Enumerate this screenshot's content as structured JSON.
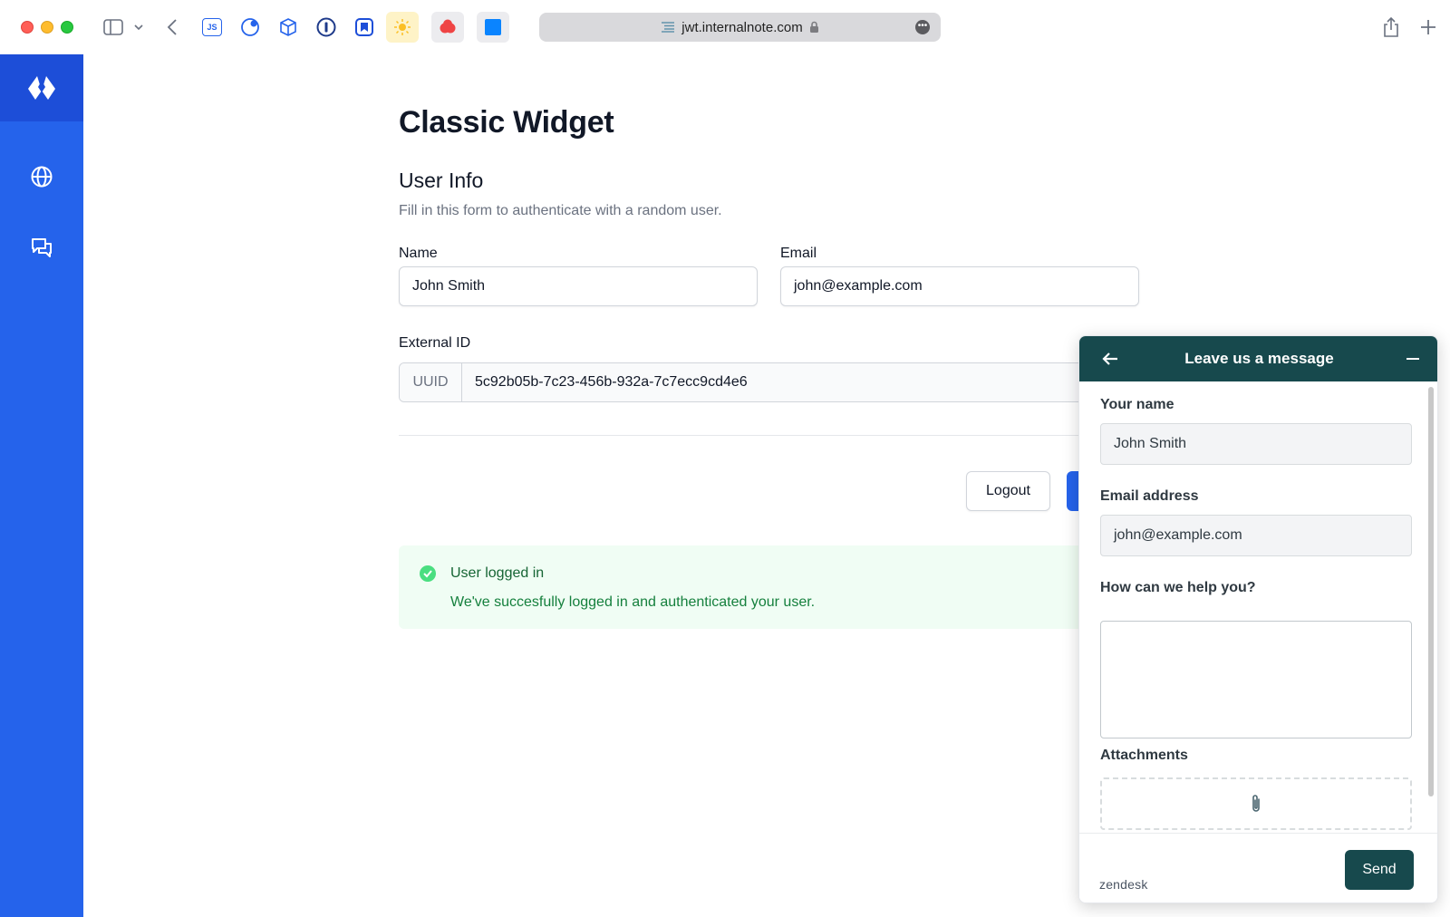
{
  "browser": {
    "url": "jwt.internalnote.com",
    "js_extension_label": "JS"
  },
  "page": {
    "title": "Classic Widget",
    "section_title": "User Info",
    "section_description": "Fill in this form to authenticate with a random user.",
    "name_label": "Name",
    "name_value": "John Smith",
    "email_label": "Email",
    "email_value": "john@example.com",
    "external_id_label": "External ID",
    "uuid_addon": "UUID",
    "uuid_value": "5c92b05b-7c23-456b-932a-7c7ecc9cd4e6",
    "logout_label": "Logout",
    "alert_title": "User logged in",
    "alert_text": "We've succesfully logged in and authenticated your user."
  },
  "widget": {
    "header_title": "Leave us a message",
    "your_name_label": "Your name",
    "your_name_value": "John Smith",
    "email_label": "Email address",
    "email_value": "john@example.com",
    "help_label": "How can we help you?",
    "help_value": "",
    "attachments_label": "Attachments",
    "brand": "zendesk",
    "send_label": "Send"
  },
  "colors": {
    "sidebar": "#2563eb",
    "primary": "#2563eb",
    "widget_header": "#17494d",
    "success_bg": "#f0fdf4",
    "success_text": "#166534"
  }
}
